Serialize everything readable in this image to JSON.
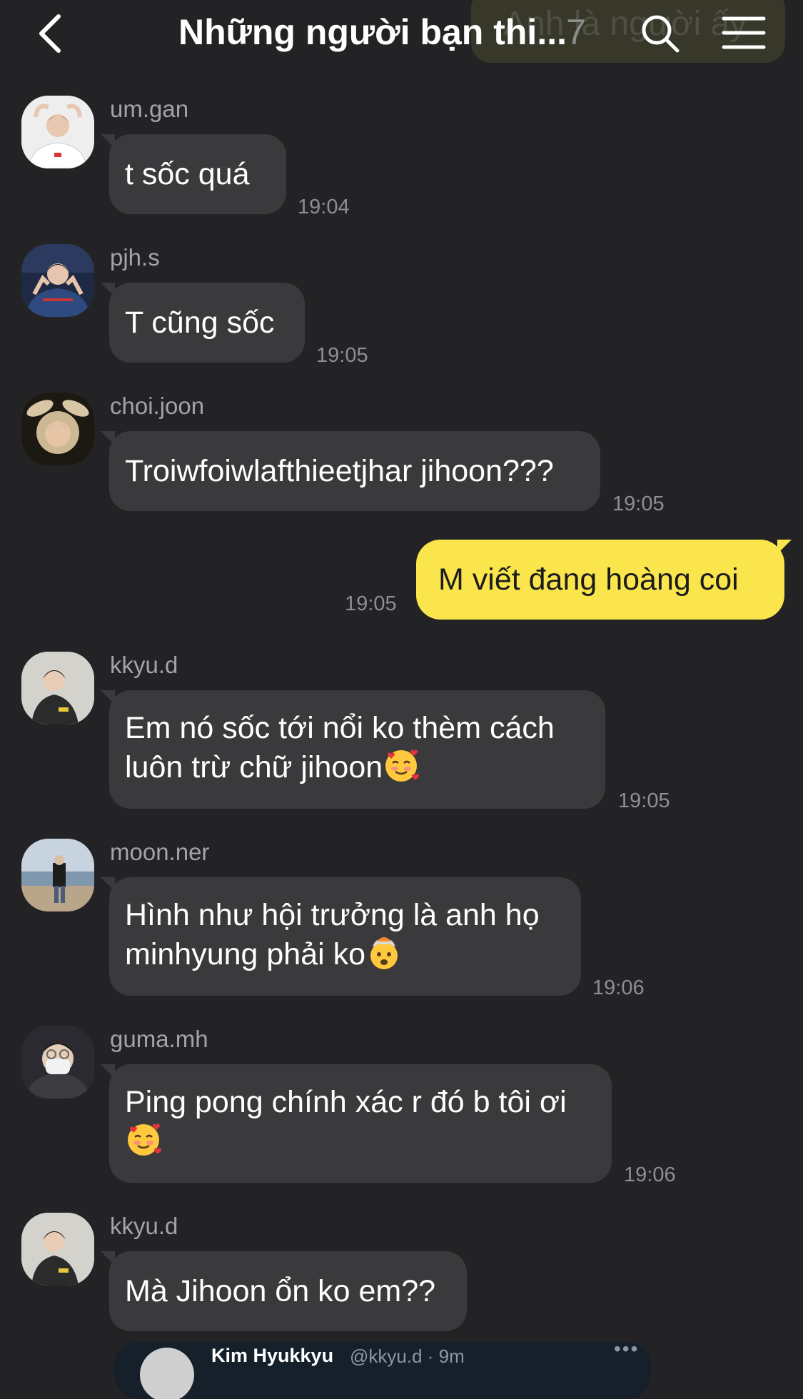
{
  "header": {
    "title": "Những người bạn thi...",
    "member_count": "7",
    "behind_text": "Anh là người ấy",
    "back_icon": "chevron-left-icon",
    "search_icon": "search-icon",
    "menu_icon": "hamburger-menu-icon"
  },
  "messages": [
    {
      "username": "um.gan",
      "text": "t sốc quá",
      "time": "19:04"
    },
    {
      "username": "pjh.s",
      "text": "T cũng sốc",
      "time": "19:05"
    },
    {
      "username": "choi.joon",
      "text": "Troiwfoiwlafthieetjhar jihoon???",
      "time": "19:05"
    },
    {
      "own": true,
      "text": "M viết đang hoàng coi",
      "time": "19:05"
    },
    {
      "username": "kkyu.d",
      "line1": "Em nó sốc tới nổi ko thèm cách",
      "line2": "luôn trừ chữ jihoon",
      "emoji": "smiling-face-with-hearts",
      "time": "19:05"
    },
    {
      "username": "moon.ner",
      "line1": "Hình như hội trưởng là anh họ",
      "line2": "minhyung phải ko",
      "emoji": "exploding-head",
      "time": "19:06"
    },
    {
      "username": "guma.mh",
      "line1": "Ping pong chính xác r đó b tôi ơi",
      "emoji": "smiling-face-with-hearts",
      "time": "19:06"
    },
    {
      "username": "kkyu.d",
      "text": "Mà Jihoon ổn ko em??"
    }
  ],
  "shared_post": {
    "name": "Kim Hyukkyu",
    "handle": "@kkyu.d · 9m",
    "more": "•••"
  },
  "colors": {
    "background": "#232325",
    "bubble": "#3a3a3c",
    "own_bubble": "#fbe54d",
    "timestamp": "#8e8e93",
    "username": "#a4a4a8"
  }
}
